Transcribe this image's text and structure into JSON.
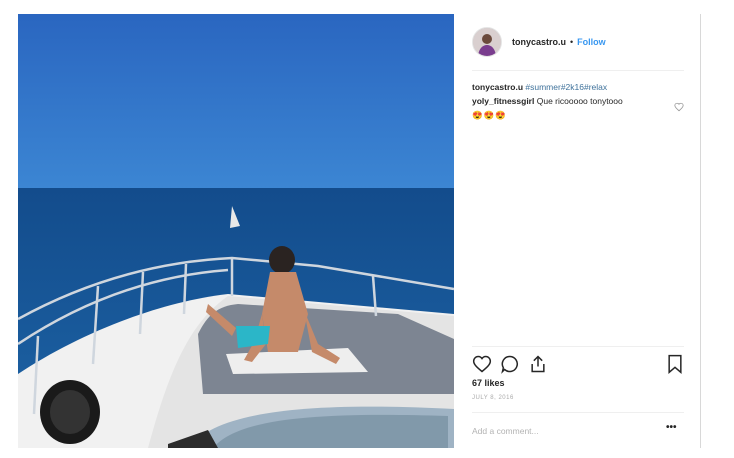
{
  "post": {
    "username": "tonycastro.u",
    "separator": "•",
    "follow_label": "Follow",
    "caption_user": "tonycastro.u",
    "caption_tags": "#summer#2k16#relax",
    "comment_user": "yoly_fitnessgirl",
    "comment_text": "Que ricooooo tonytooo",
    "comment_emoji": "😍😍😍",
    "likes": "67 likes",
    "date": "JULY 8, 2016",
    "add_comment_placeholder": "Add a comment...",
    "more_label": "•••"
  },
  "icons": [
    "heart-icon",
    "comment-icon",
    "share-icon",
    "bookmark-icon",
    "small-heart-icon"
  ],
  "colors": {
    "follow": "#3897f0",
    "hashtag": "#3f729b",
    "sky": "#2e6fc2",
    "sea": "#1b5391"
  }
}
